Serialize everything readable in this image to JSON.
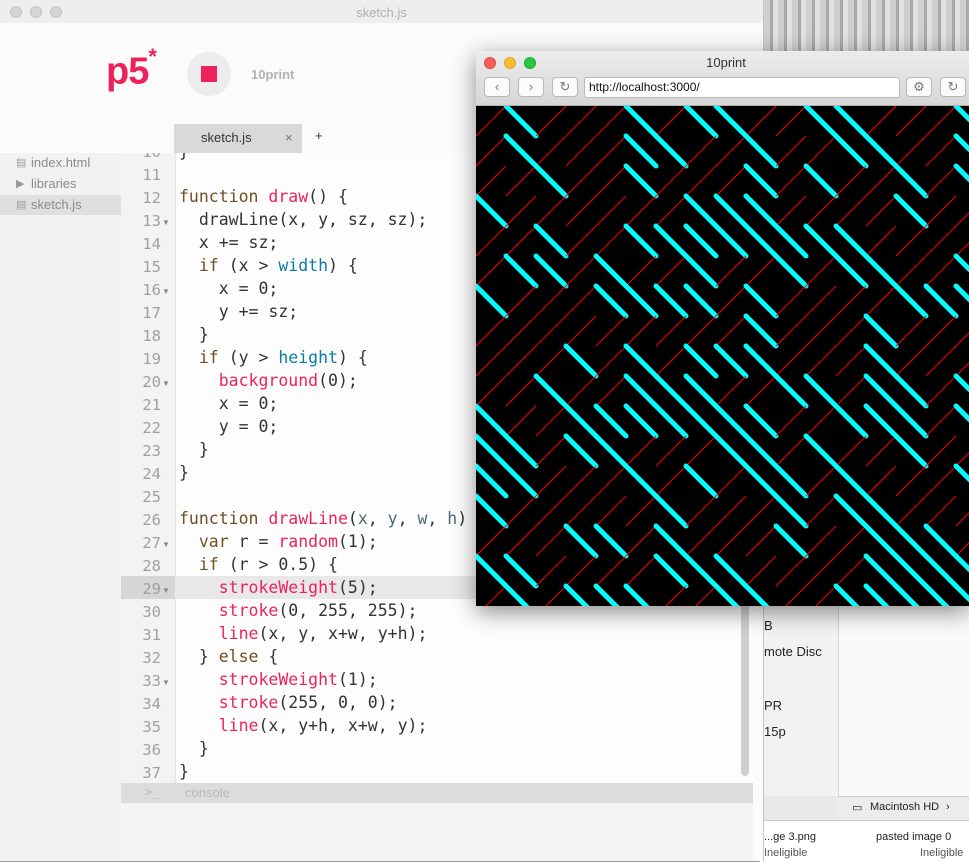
{
  "background": {
    "list_items": [
      "B",
      "mote Disc",
      "PR",
      "15p"
    ],
    "status_path": "Macintosh HD",
    "bottom_items": [
      {
        "name": "...ge 3.png",
        "status": "Ineligible"
      },
      {
        "name": "pasted image 0",
        "status": "Ineligible"
      }
    ]
  },
  "editor": {
    "window_title": "sketch.js",
    "logo": "p5",
    "logo_mark": "*",
    "project_name": "10print",
    "tab_label": "sketch.js",
    "tab_close": "×",
    "tab_add": "+",
    "files": [
      {
        "name": "index.html",
        "icon": "file-icon"
      },
      {
        "name": "libraries",
        "icon": "folder-triangle-icon"
      },
      {
        "name": "sketch.js",
        "icon": "file-icon",
        "active": true
      }
    ],
    "console_prompt": ">_",
    "console_label": "console",
    "line_numbers": [
      "10",
      "11",
      "12",
      "13",
      "14",
      "15",
      "16",
      "17",
      "18",
      "19",
      "20",
      "21",
      "22",
      "23",
      "24",
      "25",
      "26",
      "27",
      "28",
      "29",
      "30",
      "31",
      "32",
      "33",
      "34",
      "35",
      "36",
      "37"
    ],
    "code": {
      "l10": "}",
      "l12_kw": "function",
      "l12_fn": "draw",
      "l12_rest": "() {",
      "l13": "drawLine(x, y, sz, sz);",
      "l14": "x += sz;",
      "l15_kw": "if",
      "l15_a": "(x > ",
      "l15_var": "width",
      "l15_b": ") {",
      "l16": "x = 0;",
      "l17": "y += sz;",
      "l18": "}",
      "l19_kw": "if",
      "l19_a": "(y > ",
      "l19_var": "height",
      "l19_b": ") {",
      "l20_fn": "background",
      "l20_rest": "(0);",
      "l21": "x = 0;",
      "l22": "y = 0;",
      "l23": "}",
      "l24": "}",
      "l26_kw": "function",
      "l26_fn": "drawLine",
      "l26_a": "(",
      "l26_p1": "x",
      "l26_s1": ", ",
      "l26_p2": "y",
      "l26_s2": ", ",
      "l26_p3": "w",
      "l26_s3": ", ",
      "l26_p4": "h",
      "l26_b": ")",
      "l27_kw": "var",
      "l27_a": " r = ",
      "l27_fn": "random",
      "l27_b": "(1);",
      "l28_kw": "if",
      "l28_rest": "(r > 0.5) {",
      "l29_fn": "strokeWeight",
      "l29_rest": "(5);",
      "l30_fn": "stroke",
      "l30_rest": "(0, 255, 255);",
      "l31_fn": "line",
      "l31_rest": "(x, y, x+w, y+h);",
      "l32_a": "} ",
      "l32_kw": "else",
      "l32_b": " {",
      "l33_fn": "strokeWeight",
      "l33_rest": "(1);",
      "l34_fn": "stroke",
      "l34_rest": "(255, 0, 0);",
      "l35_fn": "line",
      "l35_rest": "(x, y+h, x+w, y);",
      "l36": "}",
      "l37": "}"
    }
  },
  "browser": {
    "title": "10print",
    "url": "http://localhost:3000/",
    "back": "‹",
    "forward": "›",
    "reload": "↻",
    "settings": "⚙"
  },
  "colors": {
    "p5_pink": "#ed225d",
    "cyan_line": "#00ffff",
    "red_line": "#ff0000",
    "canvas_bg": "#000000"
  }
}
